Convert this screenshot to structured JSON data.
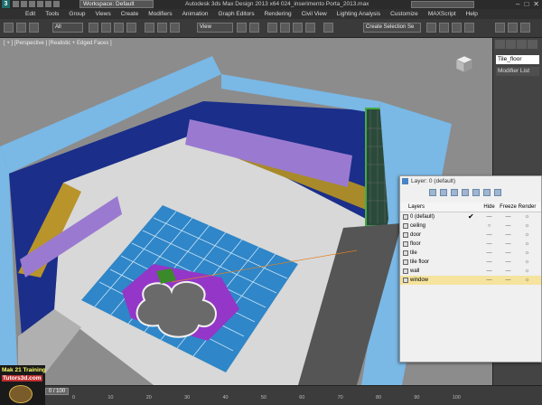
{
  "window": {
    "title": "Autodesk 3ds Max Design 2013 x64    024_inserimento Porta_2013.max",
    "workspace_label": "Workspace: Default",
    "controls": [
      "–",
      "□",
      "✕"
    ]
  },
  "menu": [
    "Edit",
    "Tools",
    "Group",
    "Views",
    "Create",
    "Modifiers",
    "Animation",
    "Graph Editors",
    "Rendering",
    "Civil View",
    "Lighting Analysis",
    "Customize",
    "MAXScript",
    "Help"
  ],
  "toolbar": {
    "selection_filter": "All",
    "reference_coord": "View",
    "named_selection_placeholder": "Create Selection Se"
  },
  "viewport": {
    "label": "[ + ] [Perspective ] [Realistic + Edged Faces ]"
  },
  "command_panel": {
    "object_name": "Tile_floor",
    "modifier_list": "Modifier List"
  },
  "layer_dialog": {
    "title": "Layer: 0 (default)",
    "columns": [
      "Layers",
      "Hide",
      "Freeze",
      "Render"
    ],
    "layers": [
      {
        "name": "0 (default)",
        "active": true
      },
      {
        "name": "ceiling"
      },
      {
        "name": "door"
      },
      {
        "name": "floor"
      },
      {
        "name": "tile"
      },
      {
        "name": "tile floor"
      },
      {
        "name": "wall"
      },
      {
        "name": "window",
        "selected": true
      }
    ]
  },
  "timeline": {
    "frame": "0 / 100",
    "ticks": [
      "0",
      "10",
      "20",
      "30",
      "40",
      "50",
      "60",
      "70",
      "80",
      "90",
      "100"
    ]
  },
  "brand": {
    "line1": "Mak 21 Training",
    "line2": "Tutors3d.com"
  }
}
